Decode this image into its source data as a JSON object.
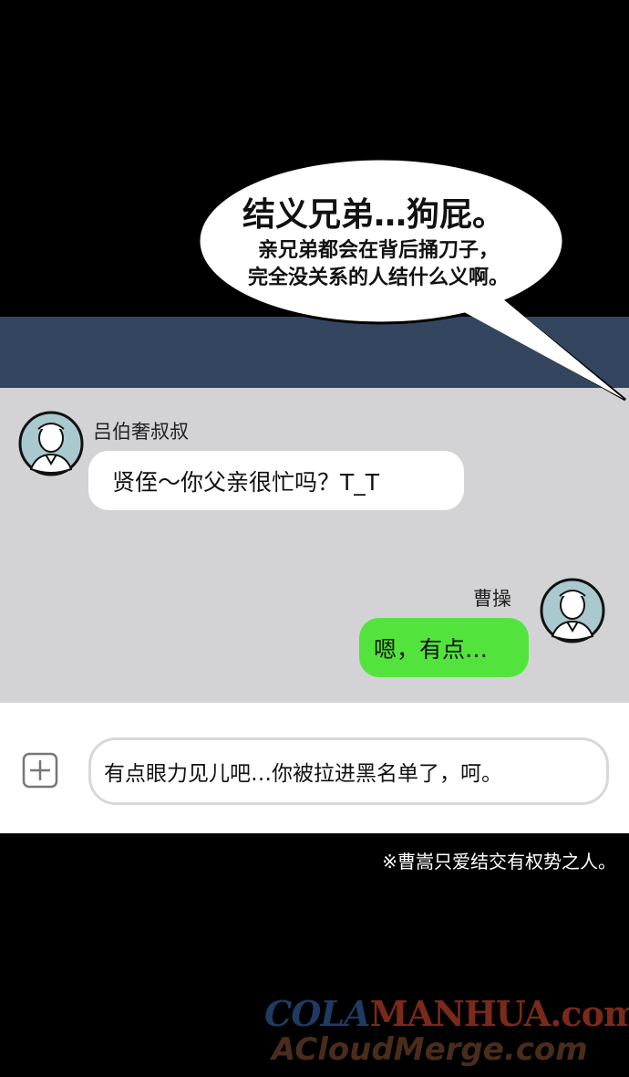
{
  "speech_bubble": {
    "title": "结义兄弟…狗屁。",
    "line1": "亲兄弟都会在背后捅刀子，",
    "line2": "完全没关系的人结什么义啊。"
  },
  "chat": {
    "messages": [
      {
        "sender": "吕伯奢叔叔",
        "text": "贤侄～你父亲很忙吗？T_T",
        "side": "left",
        "bubble_color": "#ffffff"
      },
      {
        "sender": "曹操",
        "text": "嗯，有点…",
        "side": "right",
        "bubble_color": "#52e43d"
      }
    ]
  },
  "input_bar": {
    "add_icon": "plus-square-icon",
    "value": "有点眼力见儿吧…你被拉进黑名单了，呵。"
  },
  "footnote": "※曹嵩只爱结交有权势之人。",
  "watermark": {
    "part1": "COLA",
    "part2": "MANHUA.com",
    "line2": "ACloudMerge.com"
  },
  "colors": {
    "header_bar": "#34465f",
    "chat_background": "#d3d3d5",
    "sent_bubble": "#52e43d",
    "received_bubble": "#ffffff"
  }
}
